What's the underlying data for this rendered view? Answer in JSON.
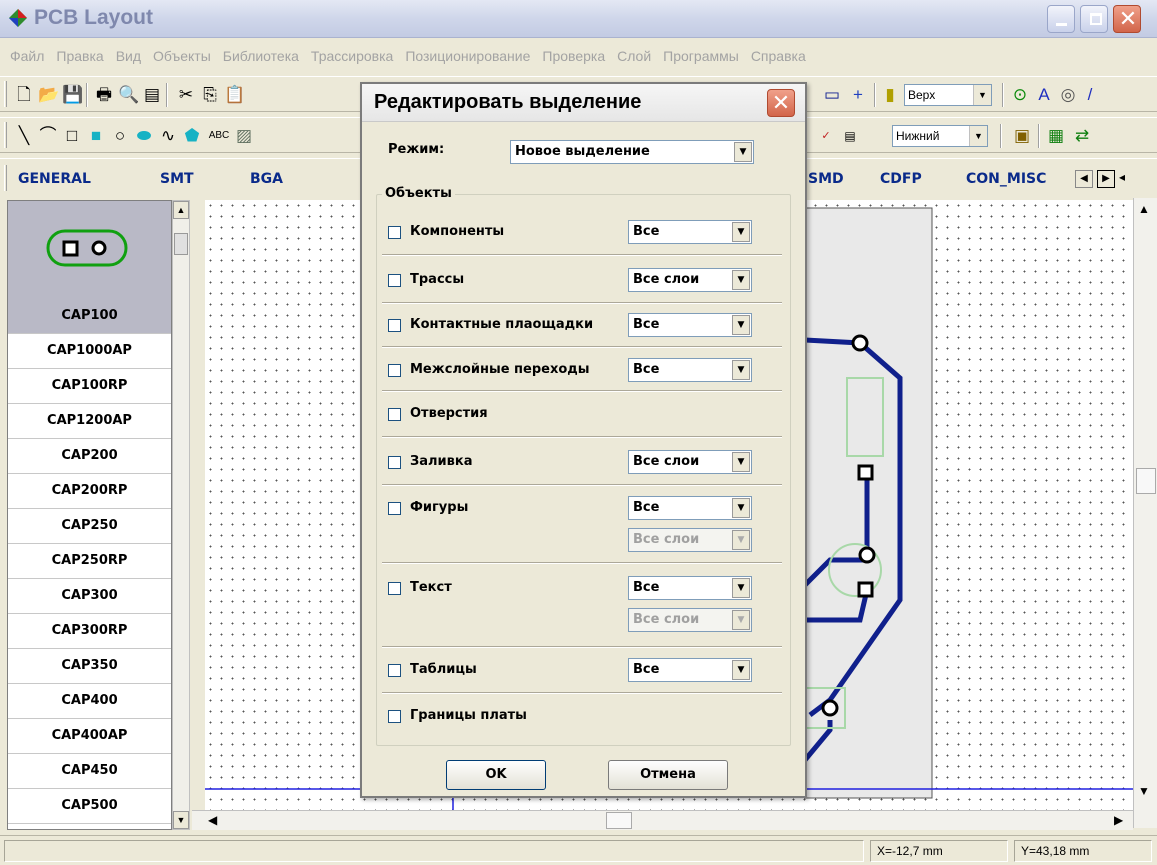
{
  "window": {
    "title": "PCB Layout"
  },
  "menu": [
    "Файл",
    "Правка",
    "Вид",
    "Объекты",
    "Библиотека",
    "Трассировка",
    "Позиционирование",
    "Проверка",
    "Слой",
    "Программы",
    "Справка"
  ],
  "toolbar": {
    "layer_top": "Верх",
    "layer_bottom": "Нижний",
    "text_tool": "ABC"
  },
  "library_tabs": [
    "GENERAL",
    "SMT",
    "BGA",
    "SMD",
    "CDFP",
    "CON_MISC"
  ],
  "components": [
    "CAP100",
    "CAP1000AP",
    "CAP100RP",
    "CAP1200AP",
    "CAP200",
    "CAP200RP",
    "CAP250",
    "CAP250RP",
    "CAP300",
    "CAP300RP",
    "CAP350",
    "CAP400",
    "CAP400AP",
    "CAP450",
    "CAP500"
  ],
  "selected_component": "CAP100",
  "status": {
    "x": "X=-12,7 mm",
    "y": "Y=43,18 mm"
  },
  "dialog": {
    "title": "Редактировать выделение",
    "mode_label": "Режим:",
    "mode_value": "Новое выделение",
    "group_label": "Объекты",
    "rows": [
      {
        "label": "Компоненты",
        "value": "Все"
      },
      {
        "label": "Трассы",
        "value": "Все слои"
      },
      {
        "label": "Контактные плаощадки",
        "value": "Все"
      },
      {
        "label": "Межслойные переходы",
        "value": "Все"
      },
      {
        "label": "Отверстия",
        "value": ""
      },
      {
        "label": "Заливка",
        "value": "Все слои"
      },
      {
        "label": "Фигуры",
        "value": "Все",
        "value2": "Все слои"
      },
      {
        "label": "Текст",
        "value": "Все",
        "value2": "Все слои"
      },
      {
        "label": "Таблицы",
        "value": "Все"
      },
      {
        "label": "Границы платы",
        "value": ""
      }
    ],
    "ok": "OK",
    "cancel": "Отмена"
  },
  "colors": {
    "trace": "#10208c",
    "silk": "#a8d8a8",
    "grid_line": "#2020e0"
  }
}
